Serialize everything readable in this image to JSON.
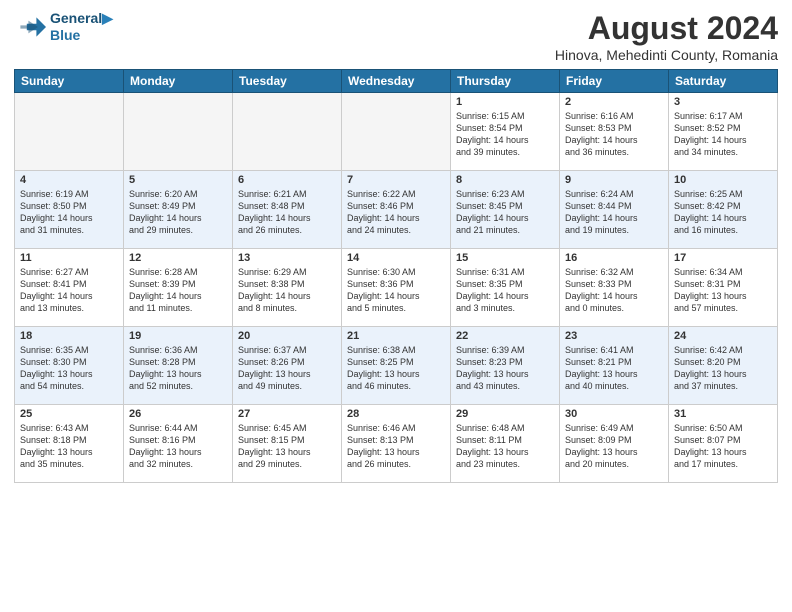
{
  "header": {
    "logo_line1": "General",
    "logo_line2": "Blue",
    "main_title": "August 2024",
    "sub_title": "Hinova, Mehedinti County, Romania"
  },
  "days_of_week": [
    "Sunday",
    "Monday",
    "Tuesday",
    "Wednesday",
    "Thursday",
    "Friday",
    "Saturday"
  ],
  "weeks": [
    [
      {
        "day": "",
        "info": ""
      },
      {
        "day": "",
        "info": ""
      },
      {
        "day": "",
        "info": ""
      },
      {
        "day": "",
        "info": ""
      },
      {
        "day": "1",
        "info": "Sunrise: 6:15 AM\nSunset: 8:54 PM\nDaylight: 14 hours\nand 39 minutes."
      },
      {
        "day": "2",
        "info": "Sunrise: 6:16 AM\nSunset: 8:53 PM\nDaylight: 14 hours\nand 36 minutes."
      },
      {
        "day": "3",
        "info": "Sunrise: 6:17 AM\nSunset: 8:52 PM\nDaylight: 14 hours\nand 34 minutes."
      }
    ],
    [
      {
        "day": "4",
        "info": "Sunrise: 6:19 AM\nSunset: 8:50 PM\nDaylight: 14 hours\nand 31 minutes."
      },
      {
        "day": "5",
        "info": "Sunrise: 6:20 AM\nSunset: 8:49 PM\nDaylight: 14 hours\nand 29 minutes."
      },
      {
        "day": "6",
        "info": "Sunrise: 6:21 AM\nSunset: 8:48 PM\nDaylight: 14 hours\nand 26 minutes."
      },
      {
        "day": "7",
        "info": "Sunrise: 6:22 AM\nSunset: 8:46 PM\nDaylight: 14 hours\nand 24 minutes."
      },
      {
        "day": "8",
        "info": "Sunrise: 6:23 AM\nSunset: 8:45 PM\nDaylight: 14 hours\nand 21 minutes."
      },
      {
        "day": "9",
        "info": "Sunrise: 6:24 AM\nSunset: 8:44 PM\nDaylight: 14 hours\nand 19 minutes."
      },
      {
        "day": "10",
        "info": "Sunrise: 6:25 AM\nSunset: 8:42 PM\nDaylight: 14 hours\nand 16 minutes."
      }
    ],
    [
      {
        "day": "11",
        "info": "Sunrise: 6:27 AM\nSunset: 8:41 PM\nDaylight: 14 hours\nand 13 minutes."
      },
      {
        "day": "12",
        "info": "Sunrise: 6:28 AM\nSunset: 8:39 PM\nDaylight: 14 hours\nand 11 minutes."
      },
      {
        "day": "13",
        "info": "Sunrise: 6:29 AM\nSunset: 8:38 PM\nDaylight: 14 hours\nand 8 minutes."
      },
      {
        "day": "14",
        "info": "Sunrise: 6:30 AM\nSunset: 8:36 PM\nDaylight: 14 hours\nand 5 minutes."
      },
      {
        "day": "15",
        "info": "Sunrise: 6:31 AM\nSunset: 8:35 PM\nDaylight: 14 hours\nand 3 minutes."
      },
      {
        "day": "16",
        "info": "Sunrise: 6:32 AM\nSunset: 8:33 PM\nDaylight: 14 hours\nand 0 minutes."
      },
      {
        "day": "17",
        "info": "Sunrise: 6:34 AM\nSunset: 8:31 PM\nDaylight: 13 hours\nand 57 minutes."
      }
    ],
    [
      {
        "day": "18",
        "info": "Sunrise: 6:35 AM\nSunset: 8:30 PM\nDaylight: 13 hours\nand 54 minutes."
      },
      {
        "day": "19",
        "info": "Sunrise: 6:36 AM\nSunset: 8:28 PM\nDaylight: 13 hours\nand 52 minutes."
      },
      {
        "day": "20",
        "info": "Sunrise: 6:37 AM\nSunset: 8:26 PM\nDaylight: 13 hours\nand 49 minutes."
      },
      {
        "day": "21",
        "info": "Sunrise: 6:38 AM\nSunset: 8:25 PM\nDaylight: 13 hours\nand 46 minutes."
      },
      {
        "day": "22",
        "info": "Sunrise: 6:39 AM\nSunset: 8:23 PM\nDaylight: 13 hours\nand 43 minutes."
      },
      {
        "day": "23",
        "info": "Sunrise: 6:41 AM\nSunset: 8:21 PM\nDaylight: 13 hours\nand 40 minutes."
      },
      {
        "day": "24",
        "info": "Sunrise: 6:42 AM\nSunset: 8:20 PM\nDaylight: 13 hours\nand 37 minutes."
      }
    ],
    [
      {
        "day": "25",
        "info": "Sunrise: 6:43 AM\nSunset: 8:18 PM\nDaylight: 13 hours\nand 35 minutes."
      },
      {
        "day": "26",
        "info": "Sunrise: 6:44 AM\nSunset: 8:16 PM\nDaylight: 13 hours\nand 32 minutes."
      },
      {
        "day": "27",
        "info": "Sunrise: 6:45 AM\nSunset: 8:15 PM\nDaylight: 13 hours\nand 29 minutes."
      },
      {
        "day": "28",
        "info": "Sunrise: 6:46 AM\nSunset: 8:13 PM\nDaylight: 13 hours\nand 26 minutes."
      },
      {
        "day": "29",
        "info": "Sunrise: 6:48 AM\nSunset: 8:11 PM\nDaylight: 13 hours\nand 23 minutes."
      },
      {
        "day": "30",
        "info": "Sunrise: 6:49 AM\nSunset: 8:09 PM\nDaylight: 13 hours\nand 20 minutes."
      },
      {
        "day": "31",
        "info": "Sunrise: 6:50 AM\nSunset: 8:07 PM\nDaylight: 13 hours\nand 17 minutes."
      }
    ]
  ]
}
